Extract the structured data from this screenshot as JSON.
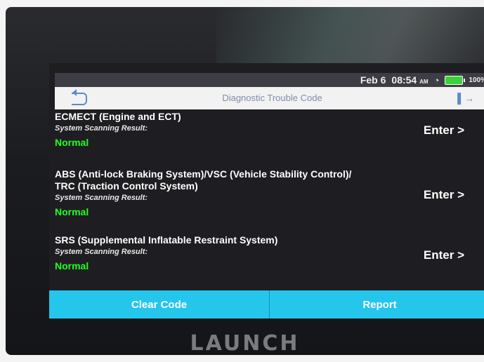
{
  "statusbar": {
    "date": "Feb 6",
    "time": "08:54",
    "ampm": "AM",
    "battery": "100%"
  },
  "header": {
    "title": "Diagnostic Trouble Code"
  },
  "systems": [
    {
      "title": "ECMECT (Engine and ECT)",
      "result_label": "System Scanning Result:",
      "status": "Normal",
      "enter": "Enter >"
    },
    {
      "title": "ABS (Anti-lock Braking System)/VSC (Vehicle Stability Control)/",
      "title2": "TRC (Traction Control System)",
      "result_label": "System Scanning Result:",
      "status": "Normal",
      "enter": "Enter >"
    },
    {
      "title": "SRS (Supplemental Inflatable Restraint System)",
      "result_label": "System Scanning Result:",
      "status": "Normal",
      "enter": "Enter >"
    }
  ],
  "buttons": {
    "clear": "Clear Code",
    "report": "Report"
  },
  "brand": "LAUNCH",
  "colors": {
    "accent": "#25c6ec",
    "status_ok": "#22ff22",
    "battery": "#3ad13a"
  }
}
